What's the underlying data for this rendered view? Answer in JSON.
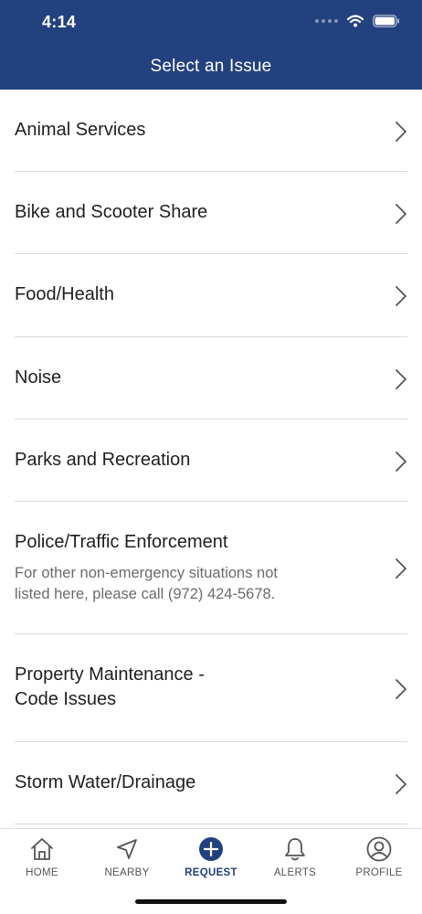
{
  "status_bar": {
    "time": "4:14"
  },
  "header": {
    "title": "Select an Issue"
  },
  "issues": [
    {
      "title": "Animal Services"
    },
    {
      "title": "Bike and Scooter Share"
    },
    {
      "title": "Food/Health"
    },
    {
      "title": "Noise"
    },
    {
      "title": "Parks and Recreation"
    },
    {
      "title": "Police/Traffic Enforcement",
      "description": "For other non-emergency situations not listed here, please call (972) 424-5678."
    },
    {
      "title_line1": "Property Maintenance -",
      "title_line2": "Code Issues"
    },
    {
      "title": "Storm Water/Drainage"
    }
  ],
  "tabbar": {
    "home": "HOME",
    "nearby": "NEARBY",
    "request": "REQUEST",
    "alerts": "ALERTS",
    "profile": "PROFILE",
    "active_tab": "request"
  },
  "colors": {
    "brand": "#23417f",
    "divider": "#d9d9d9",
    "chevron": "#555555"
  }
}
